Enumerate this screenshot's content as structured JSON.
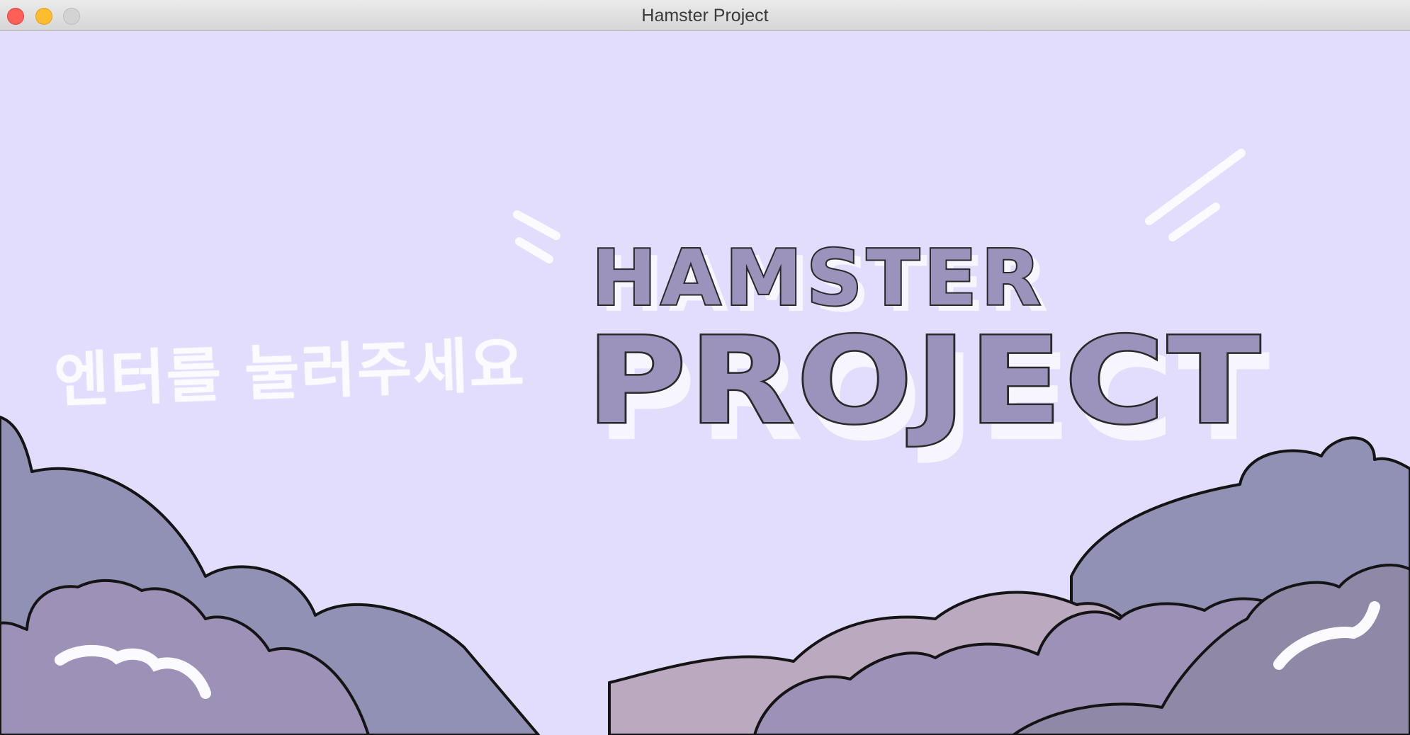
{
  "window": {
    "title": "Hamster Project"
  },
  "game": {
    "prompt": "엔터를 눌러주세요",
    "logo_line1": "HAMSTER",
    "logo_line2": "PROJECT"
  },
  "colors": {
    "sky": "#e2dcfd",
    "logo_fill": "#9b93bb",
    "logo_outline": "#2a2a2a",
    "cloud_blue": "#9191b5",
    "cloud_purple": "#9e91b7",
    "cloud_pink": "#bba9bf",
    "cloud_dark": "#8f88a6"
  }
}
